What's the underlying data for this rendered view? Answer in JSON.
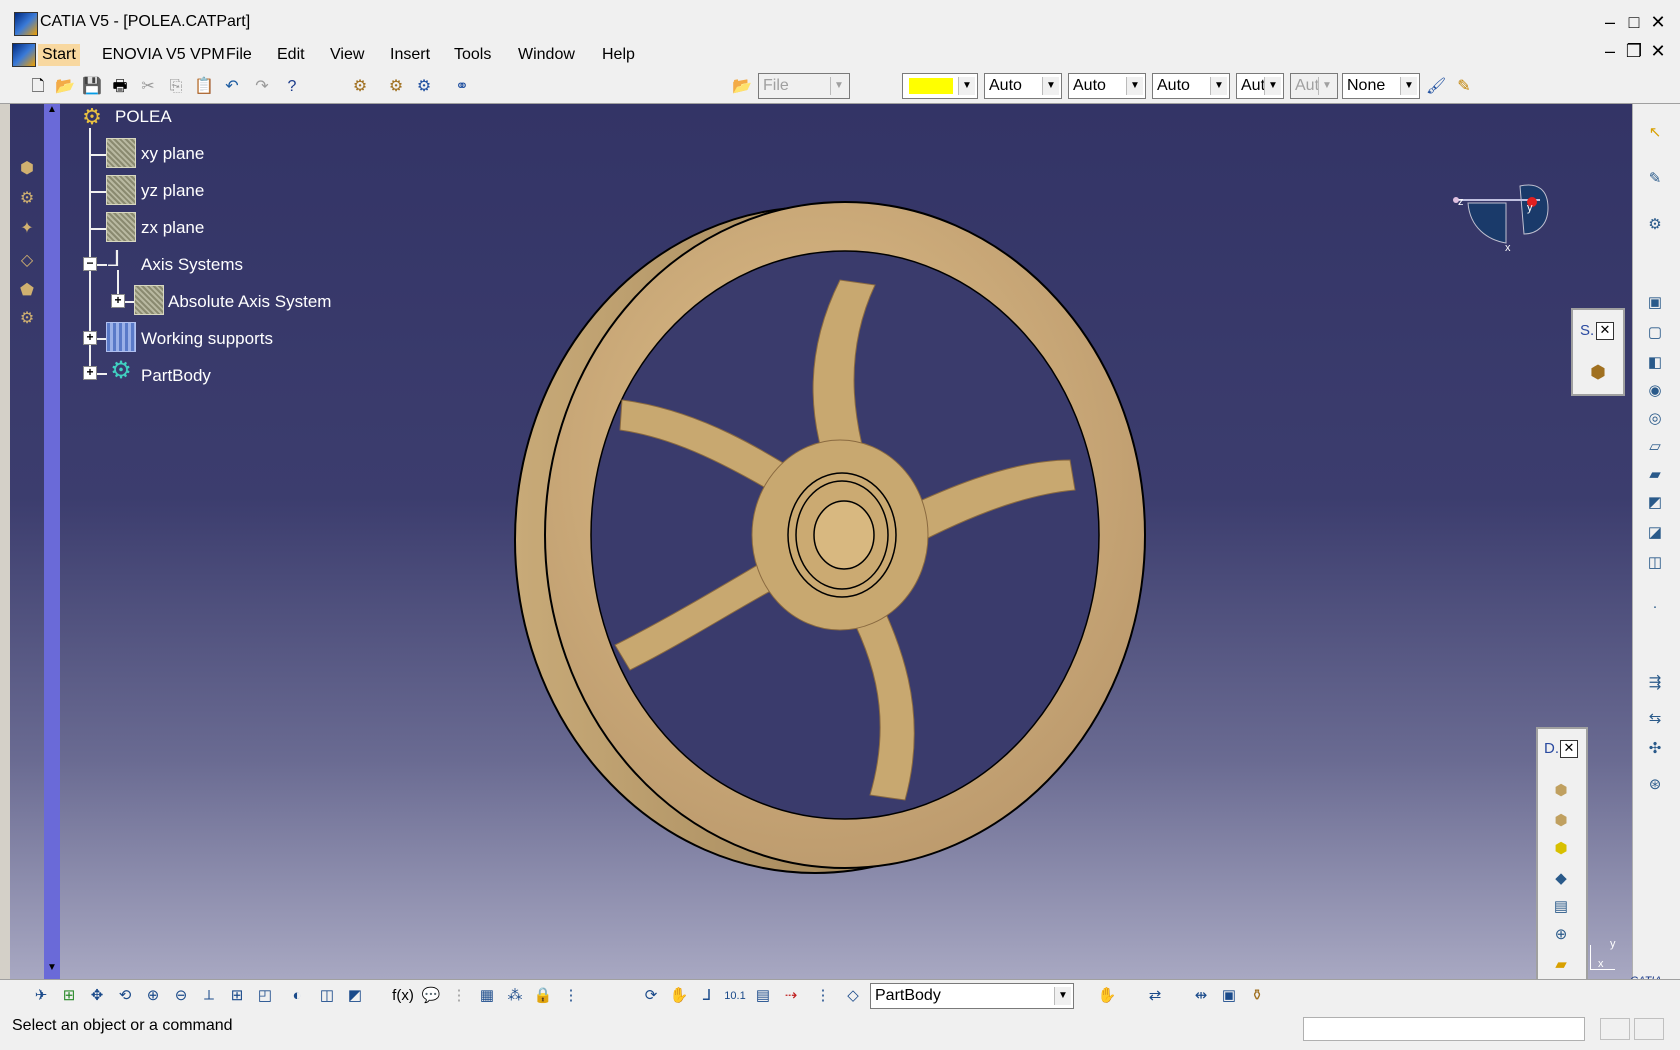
{
  "window": {
    "title": "CATIA V5 - [POLEA.CATPart]",
    "controls": [
      "–",
      "□",
      "✕"
    ],
    "doc_controls": [
      "–",
      "❐",
      "✕"
    ]
  },
  "menu": {
    "items": [
      "Start",
      "ENOVIA V5 VPM",
      "File",
      "Edit",
      "View",
      "Insert",
      "Tools",
      "Window",
      "Help"
    ]
  },
  "toolbar": {
    "file_combo": "File",
    "color_swatch": "#ffff00",
    "combos": [
      "Auto",
      "Auto",
      "Auto",
      "Aut",
      "Aut",
      "None"
    ]
  },
  "tree": {
    "root": "POLEA",
    "items": [
      "xy plane",
      "yz plane",
      "zx plane",
      "Axis Systems",
      "Absolute Axis System",
      "Working supports",
      "PartBody"
    ]
  },
  "compass": {
    "labels": [
      "z",
      "y",
      "x"
    ]
  },
  "palettes": {
    "small_title": "S.",
    "dress_title": "D."
  },
  "bottom": {
    "body_combo": "PartBody",
    "axis_labels": [
      "y",
      "x"
    ],
    "logo_text": "CATIA"
  },
  "status": {
    "text": "Select an object or a command"
  },
  "colors": {
    "viewport_top": "#333466",
    "viewport_bottom": "#a8a8c2",
    "part": "#c8a870"
  }
}
